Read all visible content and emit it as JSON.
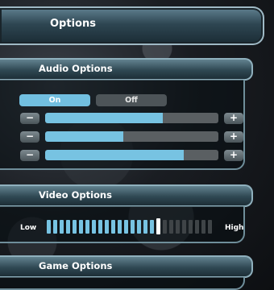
{
  "title": "Options",
  "audio": {
    "header": "Audio Options",
    "toggle_on": "On",
    "toggle_off": "Off",
    "minus": "−",
    "plus": "+",
    "sliders": [
      0.68,
      0.45,
      0.8
    ]
  },
  "video": {
    "header": "Video Options",
    "low_label": "Low",
    "high_label": "High",
    "tick_count": 26,
    "active_ticks": 18
  },
  "game": {
    "header": "Game Options"
  },
  "colors": {
    "accent": "#77c3e2",
    "inactive": "#4d5458"
  }
}
